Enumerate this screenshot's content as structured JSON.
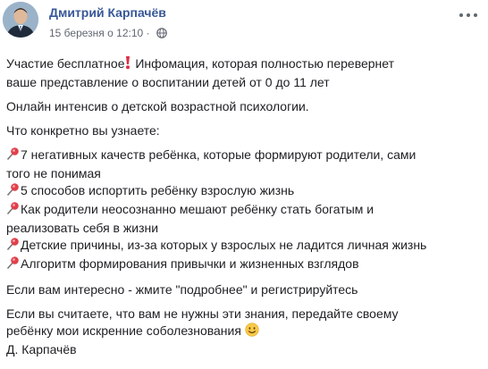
{
  "author": {
    "name": "Дмитрий Карпачёв"
  },
  "meta": {
    "timestamp": "15 березня о 12:10 ·"
  },
  "icons": {
    "privacy": "globe-icon",
    "more": "more-options-icon",
    "exclamation": "red-exclamation-icon",
    "pin": "pushpin-icon",
    "smile": "smiling-face-icon"
  },
  "colors": {
    "author": "#385898",
    "meta": "#616770",
    "text": "#1c1e21"
  },
  "post": {
    "p1_a": "Участие бесплатное",
    "p1_b": " Инфомация, которая полностью перевернет",
    "p1_c": "ваше представление о воспитании детей от 0 до 11 лет",
    "p2": "Онлайн интенсив о детской возрастной психологии.",
    "p3": "Что конкретно вы узнаете:",
    "list": [
      {
        "l1": "7 негативных качеств ребёнка, которые формируют родители, сами",
        "l2": "того не понимая"
      },
      {
        "l1": "5 способов испортить ребёнку взрослую жизнь",
        "l2": ""
      },
      {
        "l1": "Как родители неосознанно мешают ребёнку стать богатым и",
        "l2": "реализовать себя в жизни"
      },
      {
        "l1": "Детские причины, из-за которых у взрослых не ладится личная жизнь",
        "l2": ""
      },
      {
        "l1": "Алгоритм формирования привычки и жизненных взглядов",
        "l2": ""
      }
    ],
    "p4": "Если вам интересно - жмите \"подробнее\" и регистрируйтесь",
    "p5_a": "Если вы считаете, что вам не нужны эти знания, передайте своему",
    "p5_b": "ребёнку мои искренние соболезнования ",
    "signature": "Д. Карпачёв"
  }
}
